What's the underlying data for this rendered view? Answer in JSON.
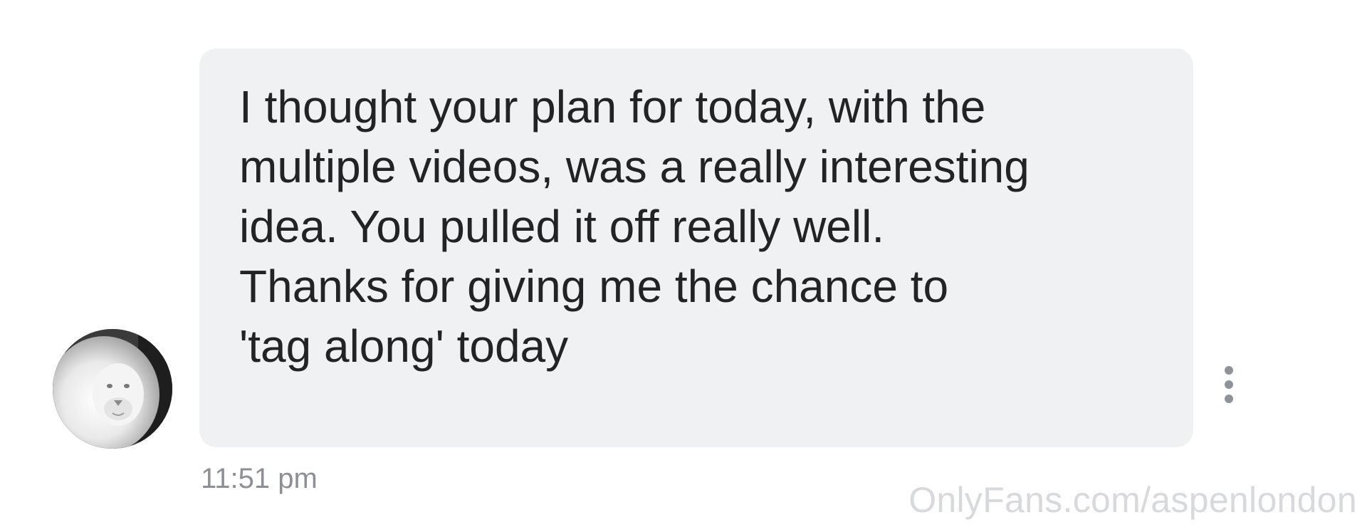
{
  "message": {
    "text": "I thought your plan for today, with the\nmultiple videos, was a really interesting\nidea. You pulled it off really well.\nThanks for giving me the chance to\n'tag along' today",
    "timestamp": "11:51 pm"
  },
  "sender": {
    "avatar_icon": "white-lion-avatar"
  },
  "actions": {
    "more_icon": "vertical-ellipsis-icon"
  },
  "watermark": "OnlyFans.com/aspenlondon",
  "colors": {
    "bubble_background": "#f0f1f3",
    "message_text": "#222325",
    "timestamp_text": "#8c9096",
    "watermark_text": "#d7d9dc",
    "menu_dots": "#8e939b"
  }
}
